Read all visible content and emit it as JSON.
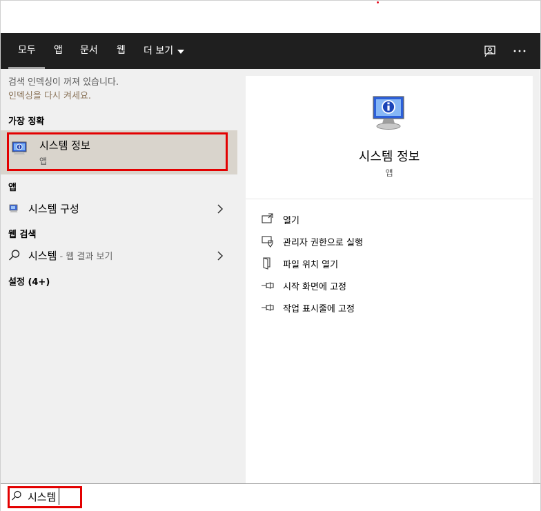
{
  "tabs": [
    {
      "label": "모두",
      "active": true
    },
    {
      "label": "앱"
    },
    {
      "label": "문서"
    },
    {
      "label": "웹"
    },
    {
      "label": "더 보기"
    }
  ],
  "header_icons": [
    "feedback-icon",
    "more-options-icon"
  ],
  "left": {
    "notice": {
      "line1": "검색 인덱싱이 꺼져 있습니다.",
      "link": "인덱싱을 다시 켜세요."
    },
    "best_match": {
      "heading": "가장 정확",
      "title": "시스템 정보",
      "subtitle": "앱"
    },
    "apps": {
      "heading": "앱",
      "items": [
        {
          "title": "시스템 구성"
        }
      ]
    },
    "web": {
      "heading": "웹 검색",
      "query": "시스템",
      "suffix": " - 웹 결과 보기"
    },
    "settings": {
      "heading": "설정 (4+)"
    }
  },
  "right": {
    "title": "시스템 정보",
    "subtitle": "앱",
    "actions": [
      {
        "label": "열기",
        "icon": "open-icon"
      },
      {
        "label": "관리자 권한으로 실행",
        "icon": "shield-icon"
      },
      {
        "label": "파일 위치 열기",
        "icon": "file-location-icon"
      },
      {
        "label": "시작 화면에 고정",
        "icon": "pin-icon"
      },
      {
        "label": "작업 표시줄에 고정",
        "icon": "pin-icon"
      }
    ]
  },
  "search": {
    "value": "시스템"
  },
  "colors": {
    "accent_highlight": "#e30000",
    "topbar": "#1f1f1f",
    "pane": "#f0f0f0",
    "selected": "#d9d4cc"
  }
}
